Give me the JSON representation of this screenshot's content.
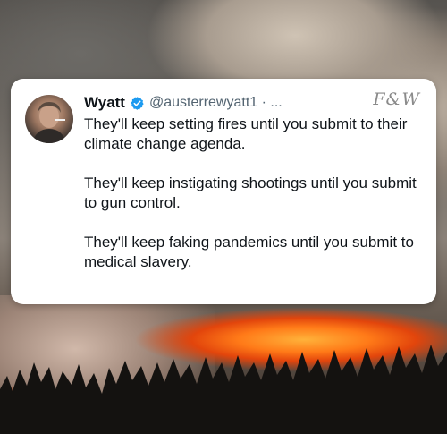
{
  "tweet": {
    "author_name": "Wyatt",
    "handle": "@austerrewyatt1 · ...",
    "watermark": "F&W",
    "paragraphs": [
      "They'll keep setting fires until you submit to their climate change agenda.",
      "They'll keep instigating shootings until you submit to gun control.",
      "They'll keep faking pandemics until you submit to medical slavery."
    ],
    "verified_icon": "verified-badge-icon",
    "verified_color": "#1d9bf0"
  },
  "background": {
    "description_icon": "wildfire-photo",
    "fire_color": "#ff7a18"
  }
}
